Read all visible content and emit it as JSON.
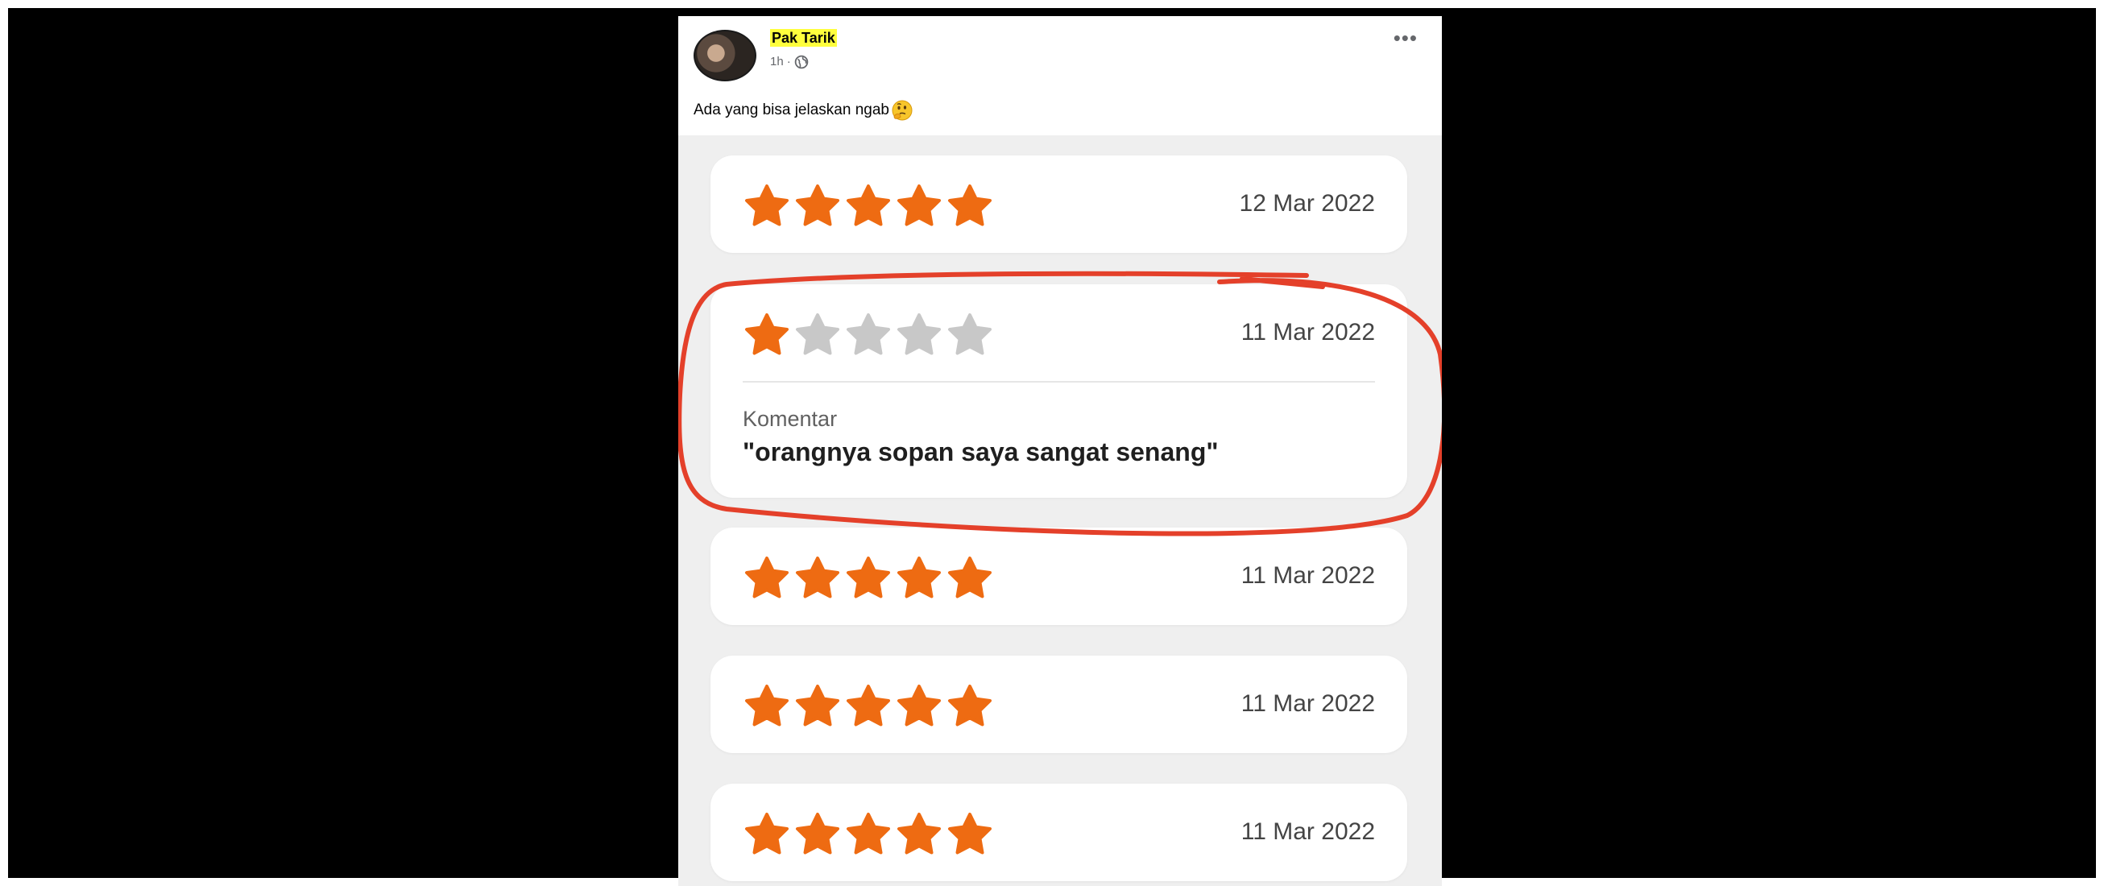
{
  "post": {
    "author": "Pak Tarik",
    "time": "1h",
    "separator": "·",
    "more_icon": "more-options-icon",
    "more_label": "•••",
    "privacy_icon": "globe-icon",
    "caption": "Ada yang bisa jelaskan ngab",
    "caption_emoji": "thinking-face-icon"
  },
  "reviews": [
    {
      "rating": 5,
      "date": "12 Mar 2022"
    },
    {
      "rating": 1,
      "date": "11 Mar 2022",
      "comment_label": "Komentar",
      "comment": "\"orangnya sopan saya sangat senang\""
    },
    {
      "rating": 5,
      "date": "11 Mar 2022"
    },
    {
      "rating": 5,
      "date": "11 Mar 2022"
    },
    {
      "rating": 5,
      "date": "11 Mar 2022"
    }
  ],
  "max_rating": 5,
  "colors": {
    "star_filled": "#ee6b12",
    "star_empty": "#c8c8c8",
    "annotation_circle": "#e4402a",
    "author_highlight": "#ffff3d"
  }
}
